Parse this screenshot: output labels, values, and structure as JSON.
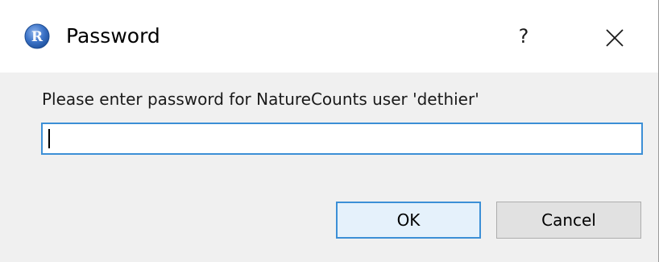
{
  "window": {
    "title": "Password",
    "app_icon_letter": "R",
    "help_label": "?",
    "close_icon": "close-icon"
  },
  "dialog": {
    "prompt": "Please enter password for NatureCounts user 'dethier'",
    "password_value": "",
    "ok_label": "OK",
    "cancel_label": "Cancel"
  },
  "colors": {
    "accent": "#3c8fd6",
    "r_logo_blue": "#2f6cc0",
    "background": "#f0f0f0"
  }
}
